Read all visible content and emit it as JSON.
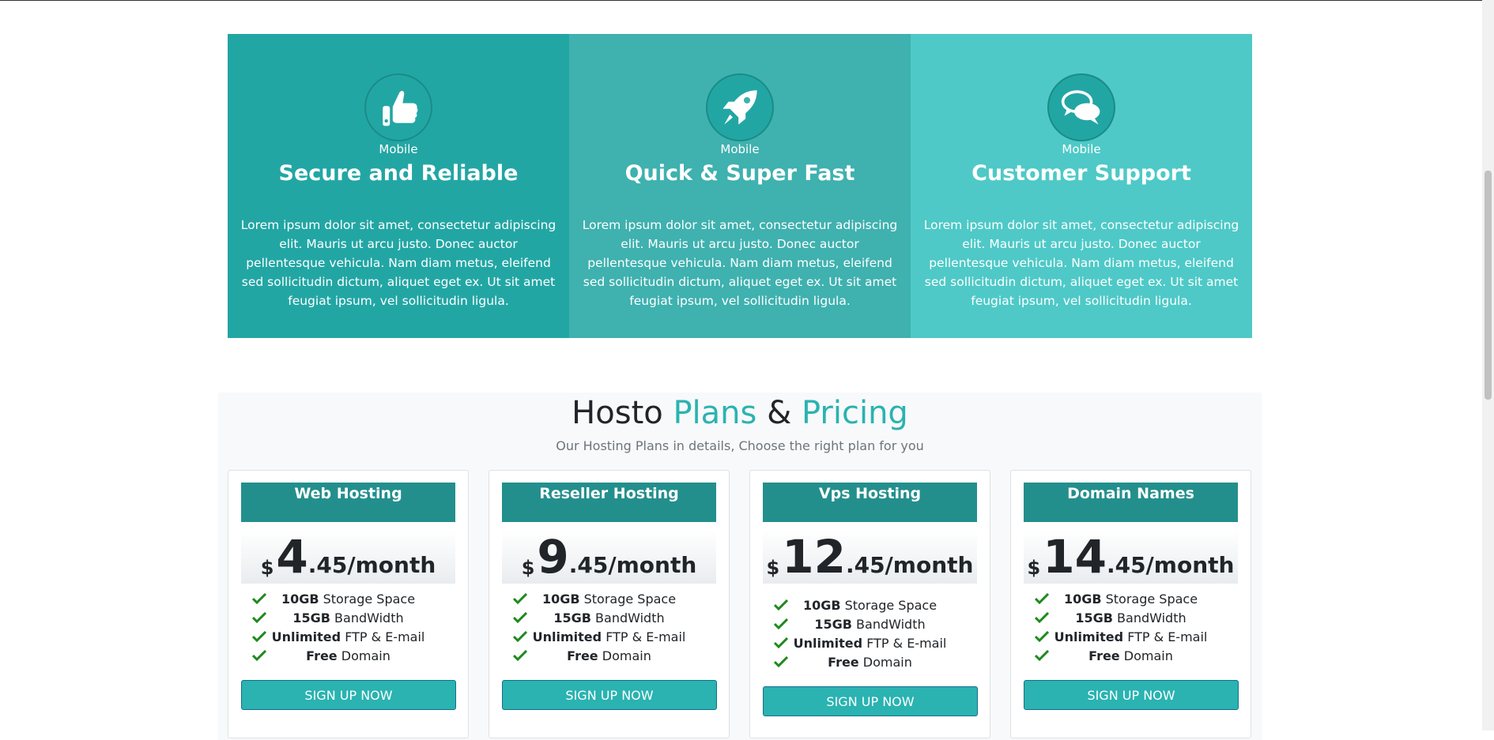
{
  "colors": {
    "feature1": "#22a6a4",
    "feature2": "#3fb1af",
    "feature3": "#4ec9c7",
    "accent": "#2ab3b1",
    "plan_header": "#238f8d",
    "check": "#1e8a1e"
  },
  "features": [
    {
      "icon": "thumbs-up-icon",
      "kicker": "Mobile",
      "title": "Secure and Reliable",
      "text": "Lorem ipsum dolor sit amet, consectetur adipiscing elit. Mauris ut arcu justo. Donec auctor pellentesque vehicula. Nam diam metus, eleifend sed sollicitudin dictum, aliquet eget ex. Ut sit amet feugiat ipsum, vel sollicitudin ligula."
    },
    {
      "icon": "rocket-icon",
      "kicker": "Mobile",
      "title": "Quick & Super Fast",
      "text": "Lorem ipsum dolor sit amet, consectetur adipiscing elit. Mauris ut arcu justo. Donec auctor pellentesque vehicula. Nam diam metus, eleifend sed sollicitudin dictum, aliquet eget ex. Ut sit amet feugiat ipsum, vel sollicitudin ligula."
    },
    {
      "icon": "chat-bubbles-icon",
      "kicker": "Mobile",
      "title": "Customer Support",
      "text": "Lorem ipsum dolor sit amet, consectetur adipiscing elit. Mauris ut arcu justo. Donec auctor pellentesque vehicula. Nam diam metus, eleifend sed sollicitudin dictum, aliquet eget ex. Ut sit amet feugiat ipsum, vel sollicitudin ligula."
    }
  ],
  "pricing": {
    "title_part1": "Hosto ",
    "title_part2": "Plans",
    "title_part3": " & ",
    "title_part4": "Pricing",
    "subtitle": "Our Hosting Plans in details, Choose the right plan for you",
    "plans": [
      {
        "name": "Web Hosting",
        "currency": "$",
        "price_main": "4",
        "price_rest": ".45/month",
        "features": [
          {
            "bold": "10GB",
            "text": " Storage Space"
          },
          {
            "bold": "15GB",
            "text": " BandWidth"
          },
          {
            "bold": "Unlimited",
            "text": " FTP & E-mail"
          },
          {
            "bold": "Free",
            "text": " Domain"
          }
        ],
        "button": "SIGN UP NOW"
      },
      {
        "name": "Reseller Hosting",
        "currency": "$",
        "price_main": "9",
        "price_rest": ".45/month",
        "features": [
          {
            "bold": "10GB",
            "text": " Storage Space"
          },
          {
            "bold": "15GB",
            "text": " BandWidth"
          },
          {
            "bold": "Unlimited",
            "text": " FTP & E-mail"
          },
          {
            "bold": "Free",
            "text": " Domain"
          }
        ],
        "button": "SIGN UP NOW"
      },
      {
        "name": "Vps Hosting",
        "currency": "$",
        "price_main": "12",
        "price_rest": ".45/month",
        "features": [
          {
            "bold": "10GB",
            "text": " Storage Space"
          },
          {
            "bold": "15GB",
            "text": " BandWidth"
          },
          {
            "bold": "Unlimited",
            "text": " FTP & E-mail"
          },
          {
            "bold": "Free",
            "text": " Domain"
          }
        ],
        "button": "SIGN UP NOW"
      },
      {
        "name": "Domain Names",
        "currency": "$",
        "price_main": "14",
        "price_rest": ".45/month",
        "features": [
          {
            "bold": "10GB",
            "text": " Storage Space"
          },
          {
            "bold": "15GB",
            "text": " BandWidth"
          },
          {
            "bold": "Unlimited",
            "text": " FTP & E-mail"
          },
          {
            "bold": "Free",
            "text": " Domain"
          }
        ],
        "button": "SIGN UP NOW"
      }
    ]
  }
}
